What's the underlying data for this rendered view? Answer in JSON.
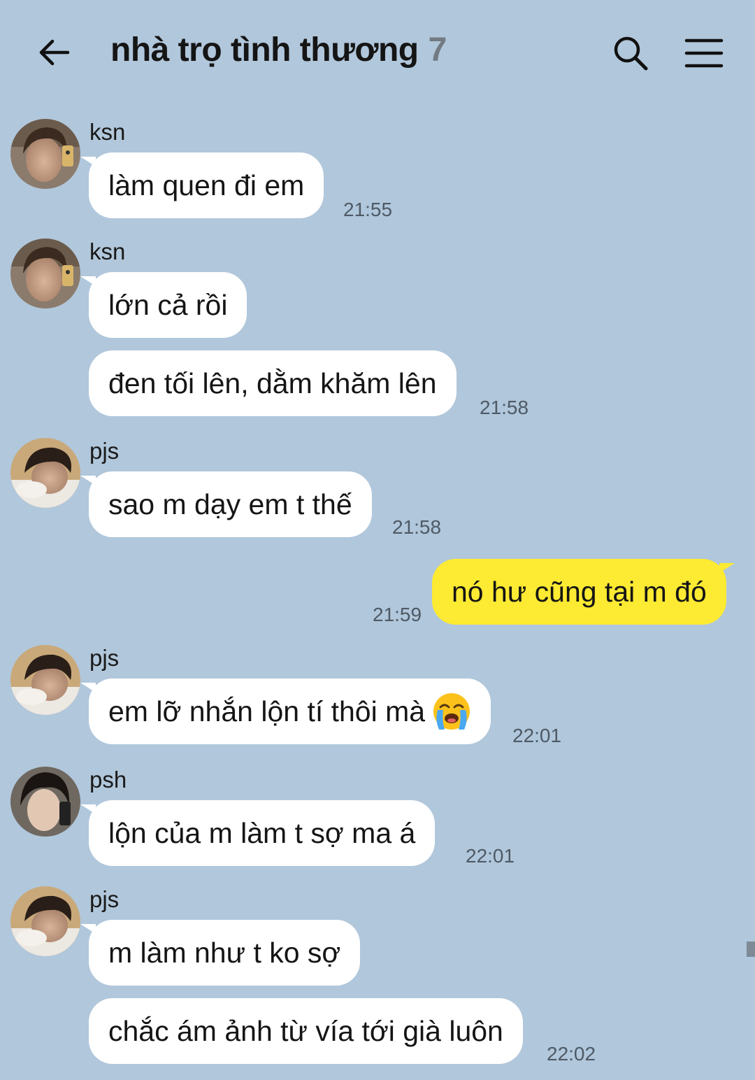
{
  "header": {
    "title": "nhà trọ tình thương",
    "member_count": "7"
  },
  "messages": [
    {
      "sender": "ksn",
      "avatar": "avatar-ksn",
      "bubbles": [
        "làm quen đi em"
      ],
      "time": "21:55"
    },
    {
      "sender": "ksn",
      "avatar": "avatar-ksn",
      "bubbles": [
        "lớn cả rồi",
        "đen tối lên, dằm khăm lên"
      ],
      "time": "21:58"
    },
    {
      "sender": "pjs",
      "avatar": "avatar-pjs",
      "bubbles": [
        "sao m dạy em t thế"
      ],
      "time": "21:58"
    },
    {
      "sender": "me",
      "bubbles": [
        "nó hư cũng tại m đó"
      ],
      "time": "21:59"
    },
    {
      "sender": "pjs",
      "avatar": "avatar-pjs",
      "bubbles": [
        "em lỡ nhắn lộn tí thôi mà"
      ],
      "emoji": "loudly-crying-face",
      "time": "22:01"
    },
    {
      "sender": "psh",
      "avatar": "avatar-psh",
      "bubbles": [
        "lộn của m làm t sợ ma á"
      ],
      "time": "22:01"
    },
    {
      "sender": "pjs",
      "avatar": "avatar-pjs",
      "bubbles": [
        "m làm như t ko sợ",
        "chắc ám ảnh từ vía tới già luôn"
      ],
      "time": "22:02"
    }
  ],
  "colors": {
    "background": "#b1c7db",
    "incoming_bubble": "#ffffff",
    "outgoing_bubble": "#fdea32"
  }
}
